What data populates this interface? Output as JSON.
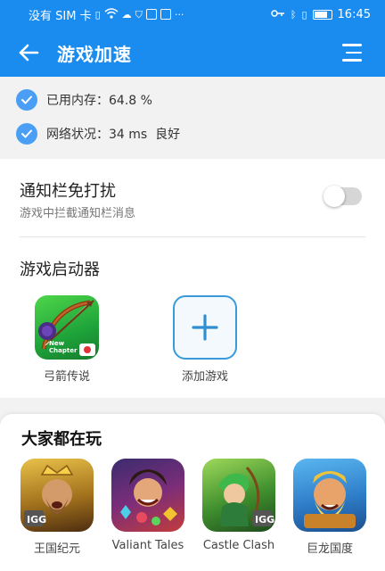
{
  "statusbar": {
    "carrier": "没有 SIM 卡",
    "time": "16:45"
  },
  "appbar": {
    "title": "游戏加速"
  },
  "stats": {
    "memory_label": "已用内存：",
    "memory_value": "64.8 %",
    "network_label": "网络状况：",
    "network_value": "34 ms  良好"
  },
  "notification": {
    "title": "通知栏免打扰",
    "subtitle": "游戏中拦截通知栏消息",
    "enabled": false
  },
  "launcher": {
    "title": "游戏启动器",
    "apps": [
      {
        "label": "弓箭传说",
        "badge_line1": "New",
        "badge_line2": "Chapter"
      },
      {
        "label": "添加游戏"
      }
    ]
  },
  "popular": {
    "title": "大家都在玩",
    "games": [
      {
        "label": "王国纪元"
      },
      {
        "label": "Valiant Tales"
      },
      {
        "label": "Castle Clash"
      },
      {
        "label": "巨龙国度"
      }
    ]
  },
  "colors": {
    "primary": "#1a8cf0",
    "check": "#4a9ff5",
    "add_border": "#3a9bdc"
  }
}
